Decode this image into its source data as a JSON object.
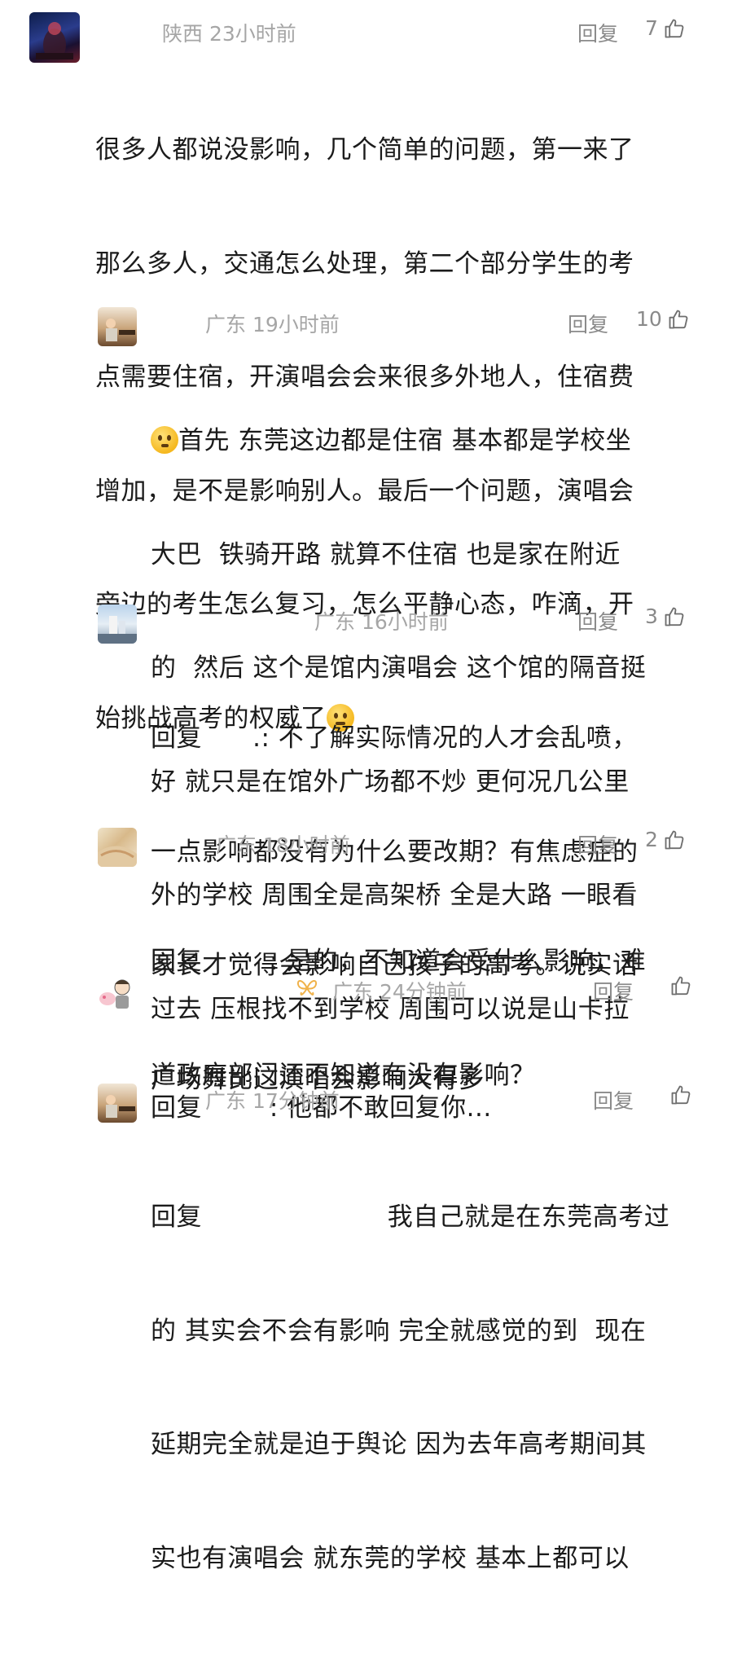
{
  "comments": [
    {
      "location": "陕西 23小时前",
      "reply_label": "回复",
      "likes": "7",
      "lines": [
        "很多人都说没影响，几个简单的问题，第一来了",
        "那么多人，交通怎么处理，第二个部分学生的考",
        "点需要住宿，开演唱会会来很多外地人，住宿费",
        "增加，是不是影响别人。最后一个问题，演唱会",
        "旁边的考生怎么复习，怎么平静心态，咋滴，开",
        "始挑战高考的权威了"
      ]
    },
    {
      "location": "广东 19小时前",
      "reply_label": "回复",
      "likes": "10",
      "lines": [
        "首先 东莞这边都是住宿 基本都是学校坐",
        "大巴  铁骑开路 就算不住宿 也是家在附近",
        "的  然后 这个是馆内演唱会 这个馆的隔音挺",
        "好 就只是在馆外广场都不炒 更何况几公里",
        "外的学校 周围全是高架桥 全是大路 一眼看",
        "过去 压根找不到学校 周围可以说是山卡拉"
      ]
    },
    {
      "location": "广东 16小时前",
      "reply_label": "回复",
      "likes": "3",
      "lines": [
        "回复      .: 不了解实际情况的人才会乱喷，",
        "一点影响都没有为什么要改期？有焦虑症的",
        "家长才觉得会影响自己孩子的高考。说实话",
        "广场舞比这演唱会影响大得多"
      ]
    },
    {
      "location": "广东 18小时前",
      "reply_label": "回复",
      "likes": "2",
      "lines": [
        "回复        : 是的，不知道会受什么影响，难",
        "道政府部门还不知道有没有影响？"
      ]
    },
    {
      "location": "广东 24分钟前",
      "reply_label": "回复",
      "likes": "",
      "lines": [
        "回复        : 他都不敢回复你..."
      ]
    },
    {
      "location": "广东 17分钟前",
      "reply_label": "回复",
      "likes": "",
      "lines": [
        "回复                      我自己就是在东莞高考过",
        "的 其实会不会有影响 完全就感觉的到  现在",
        "延期完全就是迫于舆论 因为去年高考期间其",
        "实也有演唱会 就东莞的学校 基本上都可以"
      ]
    }
  ],
  "icons": {
    "like": "thumbs-up-icon",
    "emoji_worried": "pleading-face-emoji",
    "emoji_thinking": "thinking-face-emoji",
    "badge": "butterfly-icon"
  },
  "colors": {
    "meta_text": "#a6a6a6",
    "body_text": "#1b1b1b",
    "reply_text": "#8a8a8a"
  }
}
